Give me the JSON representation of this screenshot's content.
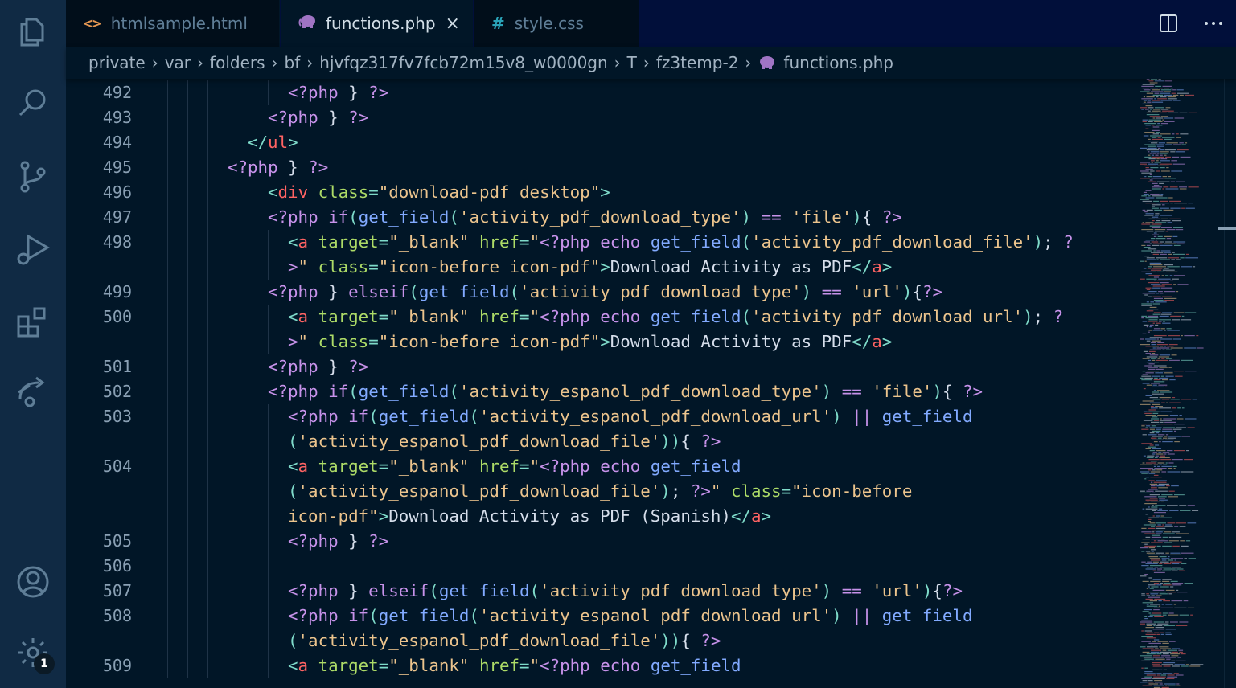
{
  "colors": {
    "activitybar_bg": "#102a44",
    "editor_bg": "#011627",
    "keyword": "#c792ea",
    "tag": "#ff6363",
    "string": "#ecc48d",
    "punct": "#7fdbca",
    "func": "#82aaff",
    "attr": "#addb67",
    "text": "#d6deeb"
  },
  "activitybar": {
    "icons": [
      "explorer-icon",
      "search-icon",
      "source-control-icon",
      "run-debug-icon",
      "extensions-icon",
      "remote-icon",
      "accounts-icon",
      "settings-gear-icon"
    ],
    "settings_badge": "1"
  },
  "tabs": [
    {
      "label": "htmlsample.html",
      "icon": "html-file-icon"
    },
    {
      "label": "functions.php",
      "icon": "php-elephant-icon",
      "close": "×"
    },
    {
      "label": "style.css",
      "icon": "css-hash-icon",
      "glyph": "#"
    }
  ],
  "html_glyph": "<>",
  "breadcrumb": [
    "private",
    "var",
    "folders",
    "bf",
    "hjvfqz317fv7fcb72m15v8_w0000gn",
    "T",
    "fz3temp-2",
    "functions.php"
  ],
  "code_lines": [
    {
      "n": "492",
      "indent": 12,
      "tokens": [
        [
          "<?php",
          "kw"
        ],
        [
          " } ",
          "tx"
        ],
        [
          "?>",
          "kw"
        ]
      ]
    },
    {
      "n": "493",
      "indent": 10,
      "tokens": [
        [
          "<?php",
          "kw"
        ],
        [
          " } ",
          "tx"
        ],
        [
          "?>",
          "kw"
        ]
      ]
    },
    {
      "n": "494",
      "indent": 8,
      "tokens": [
        [
          "</",
          "pu"
        ],
        [
          "ul",
          "tg"
        ],
        [
          ">",
          "pu"
        ]
      ]
    },
    {
      "n": "495",
      "indent": 6,
      "tokens": [
        [
          "<?php",
          "kw"
        ],
        [
          " } ",
          "tx"
        ],
        [
          "?>",
          "kw"
        ]
      ]
    },
    {
      "n": "496",
      "indent": 10,
      "tokens": [
        [
          "<",
          "pu"
        ],
        [
          "div",
          "tg"
        ],
        [
          " class",
          "at"
        ],
        [
          "=",
          "pu"
        ],
        [
          "\"download-pdf desktop\"",
          "st"
        ],
        [
          ">",
          "pu"
        ]
      ]
    },
    {
      "n": "497",
      "indent": 10,
      "tokens": [
        [
          "<?php",
          "kw"
        ],
        [
          " if",
          "kw"
        ],
        [
          "(",
          "pu"
        ],
        [
          "get_field",
          "fn"
        ],
        [
          "(",
          "pu"
        ],
        [
          "'activity_pdf_download_type'",
          "st"
        ],
        [
          ")",
          "pu"
        ],
        [
          " == ",
          "kw"
        ],
        [
          "'file'",
          "st"
        ],
        [
          ")",
          "pu"
        ],
        [
          "{ ",
          "tx"
        ],
        [
          "?>",
          "kw"
        ]
      ]
    },
    {
      "n": "498",
      "indent": 12,
      "tokens": [
        [
          "<",
          "pu"
        ],
        [
          "a",
          "tg"
        ],
        [
          " target",
          "at"
        ],
        [
          "=",
          "pu"
        ],
        [
          "\"_blank\"",
          "st"
        ],
        [
          " href",
          "at"
        ],
        [
          "=",
          "pu"
        ],
        [
          "\"",
          "st"
        ],
        [
          "<?php",
          "kw"
        ],
        [
          " echo ",
          "kw"
        ],
        [
          "get_field",
          "fn"
        ],
        [
          "(",
          "pu"
        ],
        [
          "'activity_pdf_download_file'",
          "st"
        ],
        [
          ")",
          "pu"
        ],
        [
          "; ",
          "tx"
        ],
        [
          "?",
          "kw"
        ]
      ]
    },
    {
      "n": "",
      "indent": 12,
      "tokens": [
        [
          ">",
          "kw"
        ],
        [
          "\"",
          "st"
        ],
        [
          " class",
          "at"
        ],
        [
          "=",
          "pu"
        ],
        [
          "\"icon-before icon-pdf\"",
          "st"
        ],
        [
          ">",
          "pu"
        ],
        [
          "Download Activity as PDF",
          "tx"
        ],
        [
          "</",
          "pu"
        ],
        [
          "a",
          "tg"
        ],
        [
          ">",
          "pu"
        ]
      ]
    },
    {
      "n": "499",
      "indent": 10,
      "tokens": [
        [
          "<?php",
          "kw"
        ],
        [
          " } ",
          "tx"
        ],
        [
          "elseif",
          "kw"
        ],
        [
          "(",
          "pu"
        ],
        [
          "get_field",
          "fn"
        ],
        [
          "(",
          "pu"
        ],
        [
          "'activity_pdf_download_type'",
          "st"
        ],
        [
          ")",
          "pu"
        ],
        [
          " == ",
          "kw"
        ],
        [
          "'url'",
          "st"
        ],
        [
          ")",
          "pu"
        ],
        [
          "{",
          "tx"
        ],
        [
          "?>",
          "kw"
        ]
      ]
    },
    {
      "n": "500",
      "indent": 12,
      "tokens": [
        [
          "<",
          "pu"
        ],
        [
          "a",
          "tg"
        ],
        [
          " target",
          "at"
        ],
        [
          "=",
          "pu"
        ],
        [
          "\"_blank\"",
          "st"
        ],
        [
          " href",
          "at"
        ],
        [
          "=",
          "pu"
        ],
        [
          "\"",
          "st"
        ],
        [
          "<?php",
          "kw"
        ],
        [
          " echo ",
          "kw"
        ],
        [
          "get_field",
          "fn"
        ],
        [
          "(",
          "pu"
        ],
        [
          "'activity_pdf_download_url'",
          "st"
        ],
        [
          ")",
          "pu"
        ],
        [
          "; ",
          "tx"
        ],
        [
          "?",
          "kw"
        ]
      ]
    },
    {
      "n": "",
      "indent": 12,
      "tokens": [
        [
          ">",
          "kw"
        ],
        [
          "\"",
          "st"
        ],
        [
          " class",
          "at"
        ],
        [
          "=",
          "pu"
        ],
        [
          "\"icon-before icon-pdf\"",
          "st"
        ],
        [
          ">",
          "pu"
        ],
        [
          "Download Activity as PDF",
          "tx"
        ],
        [
          "</",
          "pu"
        ],
        [
          "a",
          "tg"
        ],
        [
          ">",
          "pu"
        ]
      ]
    },
    {
      "n": "501",
      "indent": 10,
      "tokens": [
        [
          "<?php",
          "kw"
        ],
        [
          " } ",
          "tx"
        ],
        [
          "?>",
          "kw"
        ]
      ]
    },
    {
      "n": "502",
      "indent": 10,
      "tokens": [
        [
          "<?php",
          "kw"
        ],
        [
          " if",
          "kw"
        ],
        [
          "(",
          "pu"
        ],
        [
          "get_field",
          "fn"
        ],
        [
          "(",
          "pu"
        ],
        [
          "'activity_espanol_pdf_download_type'",
          "st"
        ],
        [
          ")",
          "pu"
        ],
        [
          " == ",
          "kw"
        ],
        [
          "'file'",
          "st"
        ],
        [
          ")",
          "pu"
        ],
        [
          "{ ",
          "tx"
        ],
        [
          "?>",
          "kw"
        ]
      ]
    },
    {
      "n": "503",
      "indent": 12,
      "tokens": [
        [
          "<?php",
          "kw"
        ],
        [
          " if",
          "kw"
        ],
        [
          "(",
          "pu"
        ],
        [
          "get_field",
          "fn"
        ],
        [
          "(",
          "pu"
        ],
        [
          "'activity_espanol_pdf_download_url'",
          "st"
        ],
        [
          ")",
          "pu"
        ],
        [
          " || ",
          "kw"
        ],
        [
          "get_field",
          "fn"
        ]
      ]
    },
    {
      "n": "",
      "indent": 12,
      "tokens": [
        [
          "(",
          "pu"
        ],
        [
          "'activity_espanol_pdf_download_file'",
          "st"
        ],
        [
          "))",
          "pu"
        ],
        [
          "{ ",
          "tx"
        ],
        [
          "?>",
          "kw"
        ]
      ]
    },
    {
      "n": "504",
      "indent": 12,
      "tokens": [
        [
          "<",
          "pu"
        ],
        [
          "a",
          "tg"
        ],
        [
          " target",
          "at"
        ],
        [
          "=",
          "pu"
        ],
        [
          "\"_blank\"",
          "st"
        ],
        [
          " href",
          "at"
        ],
        [
          "=",
          "pu"
        ],
        [
          "\"",
          "st"
        ],
        [
          "<?php",
          "kw"
        ],
        [
          " echo ",
          "kw"
        ],
        [
          "get_field",
          "fn"
        ]
      ]
    },
    {
      "n": "",
      "indent": 12,
      "tokens": [
        [
          "(",
          "pu"
        ],
        [
          "'activity_espanol_pdf_download_file'",
          "st"
        ],
        [
          ")",
          "pu"
        ],
        [
          "; ",
          "tx"
        ],
        [
          "?>",
          "kw"
        ],
        [
          "\"",
          "st"
        ],
        [
          " class",
          "at"
        ],
        [
          "=",
          "pu"
        ],
        [
          "\"icon-before",
          "st"
        ]
      ]
    },
    {
      "n": "",
      "indent": 12,
      "tokens": [
        [
          "icon-pdf\"",
          "st"
        ],
        [
          ">",
          "pu"
        ],
        [
          "Download Activity as PDF (Spanish)",
          "tx"
        ],
        [
          "</",
          "pu"
        ],
        [
          "a",
          "tg"
        ],
        [
          ">",
          "pu"
        ]
      ]
    },
    {
      "n": "505",
      "indent": 12,
      "tokens": [
        [
          "<?php",
          "kw"
        ],
        [
          " } ",
          "tx"
        ],
        [
          "?>",
          "kw"
        ]
      ]
    },
    {
      "n": "506",
      "indent": 12,
      "tokens": []
    },
    {
      "n": "507",
      "indent": 12,
      "tokens": [
        [
          "<?php",
          "kw"
        ],
        [
          " } ",
          "tx"
        ],
        [
          "elseif",
          "kw"
        ],
        [
          "(",
          "pu"
        ],
        [
          "get_field",
          "fn"
        ],
        [
          "(",
          "pu"
        ],
        [
          "'activity_pdf_download_type'",
          "st"
        ],
        [
          ")",
          "pu"
        ],
        [
          " == ",
          "kw"
        ],
        [
          "'url'",
          "st"
        ],
        [
          ")",
          "pu"
        ],
        [
          "{",
          "tx"
        ],
        [
          "?>",
          "kw"
        ]
      ]
    },
    {
      "n": "508",
      "indent": 12,
      "tokens": [
        [
          "<?php",
          "kw"
        ],
        [
          " if",
          "kw"
        ],
        [
          "(",
          "pu"
        ],
        [
          "get_field",
          "fn"
        ],
        [
          "(",
          "pu"
        ],
        [
          "'activity_espanol_pdf_download_url'",
          "st"
        ],
        [
          ")",
          "pu"
        ],
        [
          " || ",
          "kw"
        ],
        [
          "get_field",
          "fn"
        ]
      ]
    },
    {
      "n": "",
      "indent": 12,
      "tokens": [
        [
          "(",
          "pu"
        ],
        [
          "'activity_espanol_pdf_download_file'",
          "st"
        ],
        [
          "))",
          "pu"
        ],
        [
          "{ ",
          "tx"
        ],
        [
          "?>",
          "kw"
        ]
      ]
    },
    {
      "n": "509",
      "indent": 12,
      "tokens": [
        [
          "<",
          "pu"
        ],
        [
          "a",
          "tg"
        ],
        [
          " target",
          "at"
        ],
        [
          "=",
          "pu"
        ],
        [
          "\"_blank\"",
          "st"
        ],
        [
          " href",
          "at"
        ],
        [
          "=",
          "pu"
        ],
        [
          "\"",
          "st"
        ],
        [
          "<?php",
          "kw"
        ],
        [
          " echo ",
          "kw"
        ],
        [
          "get_field",
          "fn"
        ]
      ]
    }
  ]
}
